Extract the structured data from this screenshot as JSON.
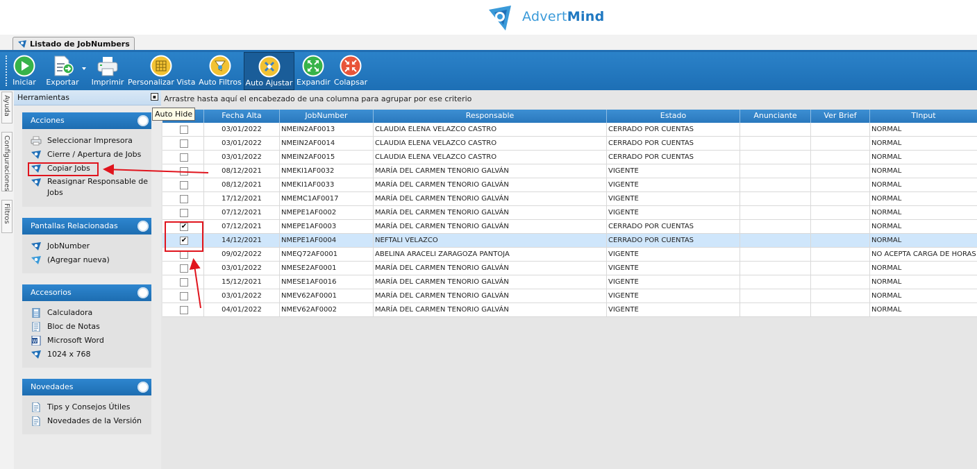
{
  "brand": {
    "name_light": "Advert",
    "name_bold": "Mind"
  },
  "window_tab": {
    "label": "Listado de JobNumbers"
  },
  "toolbar": {
    "buttons": [
      {
        "label": "Iniciar",
        "icon": "play-icon"
      },
      {
        "label": "Exportar",
        "icon": "export-icon"
      },
      {
        "label": "Imprimir",
        "icon": "printer-icon"
      },
      {
        "label": "Personalizar Vista",
        "icon": "grid-icon"
      },
      {
        "label": "Auto Filtros",
        "icon": "filter-icon"
      },
      {
        "label": "Auto Ajustar",
        "icon": "auto-fit-icon",
        "active": true
      },
      {
        "label": "Expandir",
        "icon": "expand-icon"
      },
      {
        "label": "Colapsar",
        "icon": "collapse-icon"
      }
    ]
  },
  "side_tabs": [
    "Ayuda",
    "Configuraciones",
    "Filtros"
  ],
  "tools": {
    "title": "Herramientas",
    "tooltip": "Auto Hide",
    "panels": [
      {
        "title": "Acciones",
        "items": [
          "Seleccionar Impresora",
          "Cierre / Apertura de Jobs",
          "Copiar Jobs",
          "Reasignar Responsable de Jobs"
        ]
      },
      {
        "title": "Pantallas Relacionadas",
        "items": [
          "JobNumber",
          "(Agregar nueva)"
        ]
      },
      {
        "title": "Accesorios",
        "items": [
          "Calculadora",
          "Bloc de Notas",
          "Microsoft Word",
          "1024 x 768"
        ]
      },
      {
        "title": "Novedades",
        "items": [
          "Tips y Consejos Útiles",
          "Novedades de la Versión"
        ]
      }
    ]
  },
  "grid": {
    "group_hint": "Arrastre hasta aquí el encabezado de una columna para agrupar por ese criterio",
    "columns": [
      "Fecha Alta",
      "JobNumber",
      "Responsable",
      "Estado",
      "Anunciante",
      "Ver Brief",
      "TInput"
    ],
    "rows": [
      {
        "checked": false,
        "fecha": "03/01/2022",
        "job": "NMEIN2AF0013",
        "resp": "CLAUDIA ELENA VELAZCO CASTRO",
        "estado": "CERRADO POR CUENTAS",
        "tinput": "NORMAL"
      },
      {
        "checked": false,
        "fecha": "03/01/2022",
        "job": "NMEIN2AF0014",
        "resp": "CLAUDIA ELENA VELAZCO CASTRO",
        "estado": "CERRADO POR CUENTAS",
        "tinput": "NORMAL"
      },
      {
        "checked": false,
        "fecha": "03/01/2022",
        "job": "NMEIN2AF0015",
        "resp": "CLAUDIA ELENA VELAZCO CASTRO",
        "estado": "CERRADO POR CUENTAS",
        "tinput": "NORMAL"
      },
      {
        "checked": false,
        "fecha": "08/12/2021",
        "job": "NMEKI1AF0032",
        "resp": "MARÍA DEL CARMEN TENORIO GALVÁN",
        "estado": "VIGENTE",
        "tinput": "NORMAL"
      },
      {
        "checked": false,
        "fecha": "08/12/2021",
        "job": "NMEKI1AF0033",
        "resp": "MARÍA DEL CARMEN TENORIO GALVÁN",
        "estado": "VIGENTE",
        "tinput": "NORMAL"
      },
      {
        "checked": false,
        "fecha": "17/12/2021",
        "job": "NMEMC1AF0017",
        "resp": "MARÍA DEL CARMEN TENORIO GALVÁN",
        "estado": "VIGENTE",
        "tinput": "NORMAL"
      },
      {
        "checked": false,
        "fecha": "07/12/2021",
        "job": "NMEPE1AF0002",
        "resp": "MARÍA DEL CARMEN TENORIO GALVÁN",
        "estado": "VIGENTE",
        "tinput": "NORMAL"
      },
      {
        "checked": true,
        "fecha": "07/12/2021",
        "job": "NMEPE1AF0003",
        "resp": "MARÍA DEL CARMEN TENORIO GALVÁN",
        "estado": "CERRADO POR CUENTAS",
        "tinput": "NORMAL"
      },
      {
        "checked": true,
        "selected": true,
        "fecha": "14/12/2021",
        "job": "NMEPE1AF0004",
        "resp": "NEFTALI VELAZCO",
        "estado": "CERRADO POR CUENTAS",
        "tinput": "NORMAL"
      },
      {
        "checked": false,
        "fecha": "09/02/2022",
        "job": "NMEQ72AF0001",
        "resp": "ABELINA ARACELI ZARAGOZA PANTOJA",
        "estado": "VIGENTE",
        "tinput": "NO ACEPTA CARGA DE HORAS"
      },
      {
        "checked": false,
        "fecha": "03/01/2022",
        "job": "NMESE2AF0001",
        "resp": "MARÍA DEL CARMEN TENORIO GALVÁN",
        "estado": "VIGENTE",
        "tinput": "NORMAL"
      },
      {
        "checked": false,
        "fecha": "15/12/2021",
        "job": "NMESE1AF0016",
        "resp": "MARÍA DEL CARMEN TENORIO GALVÁN",
        "estado": "VIGENTE",
        "tinput": "NORMAL"
      },
      {
        "checked": false,
        "fecha": "03/01/2022",
        "job": "NMEV62AF0001",
        "resp": "MARÍA DEL CARMEN TENORIO GALVÁN",
        "estado": "VIGENTE",
        "tinput": "NORMAL"
      },
      {
        "checked": false,
        "fecha": "04/01/2022",
        "job": "NMEV62AF0002",
        "resp": "MARÍA DEL CARMEN TENORIO GALVÁN",
        "estado": "VIGENTE",
        "tinput": "NORMAL"
      }
    ]
  },
  "colors": {
    "toolbar_blue": "#1f74bb",
    "panel_header": "#2478c0",
    "annotation_red": "#e0141d",
    "brand_blue": "#3a9ad9"
  }
}
